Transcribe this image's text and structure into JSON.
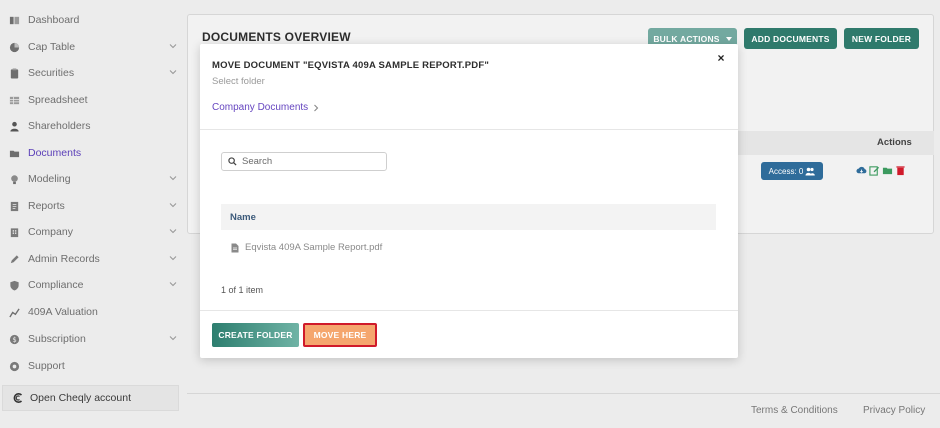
{
  "sidebar": {
    "items": [
      {
        "label": "Dashboard",
        "icon": "dashboard-icon",
        "has_chevron": false
      },
      {
        "label": "Cap Table",
        "icon": "pie-chart-icon",
        "has_chevron": true
      },
      {
        "label": "Securities",
        "icon": "clipboard-icon",
        "has_chevron": true
      },
      {
        "label": "Spreadsheet",
        "icon": "spreadsheet-icon",
        "has_chevron": false
      },
      {
        "label": "Shareholders",
        "icon": "person-icon",
        "has_chevron": false
      },
      {
        "label": "Documents",
        "icon": "folder-icon",
        "has_chevron": false,
        "active": true
      },
      {
        "label": "Modeling",
        "icon": "bulb-icon",
        "has_chevron": true
      },
      {
        "label": "Reports",
        "icon": "report-icon",
        "has_chevron": true
      },
      {
        "label": "Company",
        "icon": "building-icon",
        "has_chevron": true
      },
      {
        "label": "Admin Records",
        "icon": "pen-icon",
        "has_chevron": true
      },
      {
        "label": "Compliance",
        "icon": "shield-icon",
        "has_chevron": true
      },
      {
        "label": "409A Valuation",
        "icon": "valuation-icon",
        "has_chevron": false
      },
      {
        "label": "Subscription",
        "icon": "dollar-icon",
        "has_chevron": true
      },
      {
        "label": "Support",
        "icon": "support-icon",
        "has_chevron": false
      }
    ],
    "cheqly_label": "Open Cheqly account"
  },
  "page": {
    "title": "DOCUMENTS OVERVIEW",
    "bulk_actions_label": "BULK ACTIONS",
    "add_documents_label": "ADD DOCUMENTS",
    "new_folder_label": "NEW FOLDER",
    "actions_header": "Actions",
    "access_label": "Access: 0"
  },
  "modal": {
    "title": "MOVE DOCUMENT \"EQVISTA 409A SAMPLE REPORT.PDF\"",
    "subtitle": "Select folder",
    "close_glyph": "×",
    "breadcrumb": "Company Documents",
    "search_placeholder": "Search",
    "column_name": "Name",
    "files": [
      {
        "name": "Eqvista 409A Sample Report.pdf"
      }
    ],
    "count_text": "1 of 1 item",
    "create_folder_label": "CREATE FOLDER",
    "move_here_label": "MOVE HERE"
  },
  "footer": {
    "terms": "Terms & Conditions",
    "privacy": "Privacy Policy"
  },
  "colors": {
    "accent_purple": "#5b3fb8",
    "teal": "#2f7a6c",
    "move_orange": "#f5a66e",
    "highlight_red": "#d01a2a",
    "access_blue": "#2f6c9a"
  }
}
